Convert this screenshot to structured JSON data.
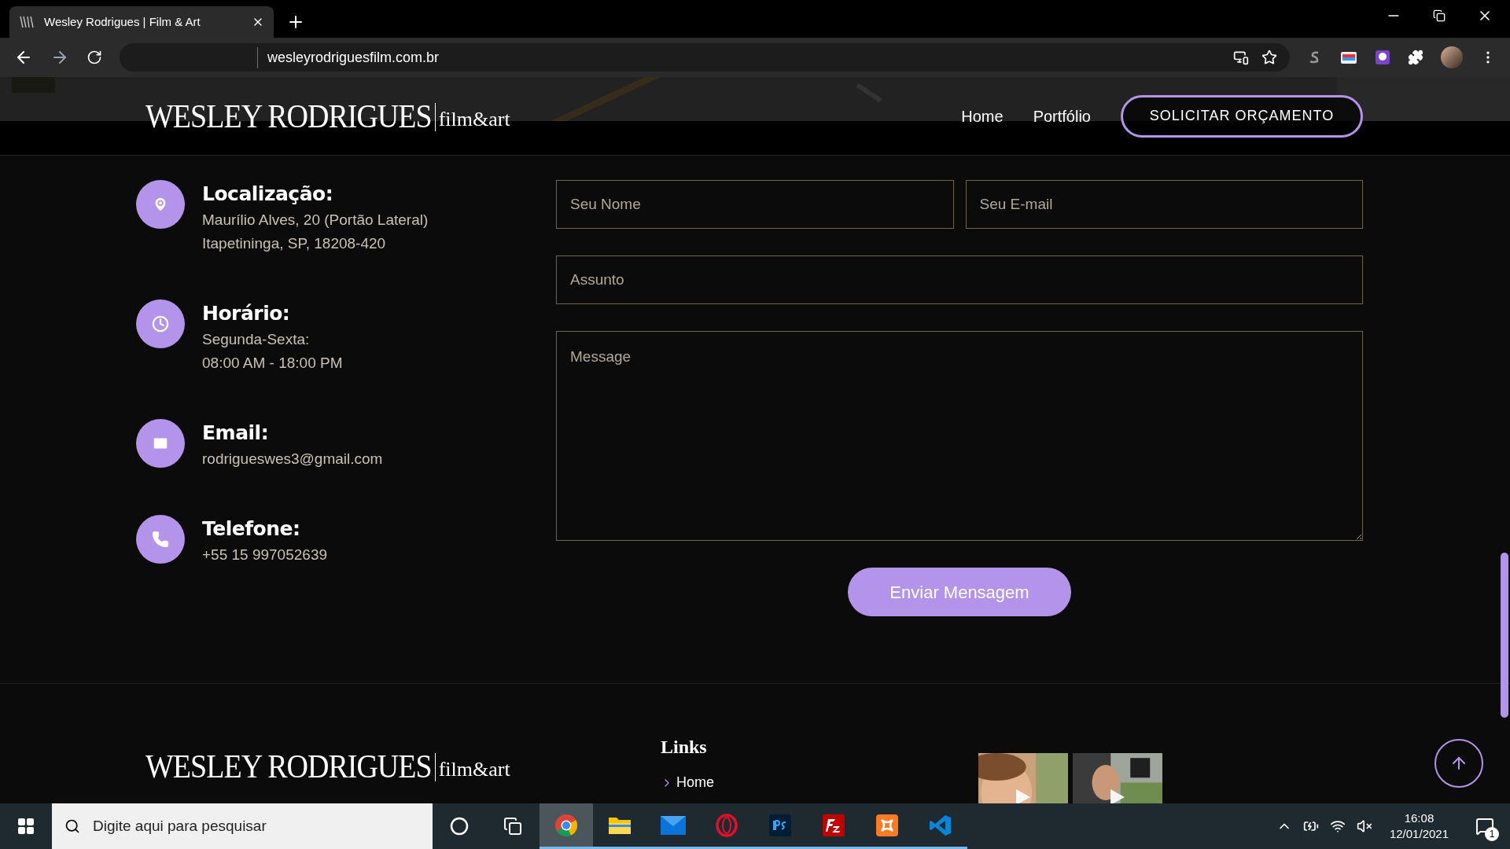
{
  "browser": {
    "tab": {
      "title": "Wesley Rodrigues | Film & Art"
    },
    "address": "wesleyrodriguesfilm.com.br"
  },
  "header": {
    "logo": {
      "name": "WESLEY RODRIGUES",
      "tagline": "film&art"
    },
    "nav": [
      {
        "label": "Home"
      },
      {
        "label": "Portfólio"
      }
    ],
    "cta": "SOLICITAR ORÇAMENTO"
  },
  "contact": [
    {
      "kind": "location",
      "title": "Localização:",
      "lines": [
        "Maurílio Alves, 20 (Portão Lateral)",
        "Itapetininga, SP, 18208-420"
      ]
    },
    {
      "kind": "hours",
      "title": "Horário:",
      "lines": [
        "Segunda-Sexta:",
        "08:00 AM - 18:00 PM"
      ]
    },
    {
      "kind": "email",
      "title": "Email:",
      "lines": [
        "rodrigueswes3@gmail.com"
      ]
    },
    {
      "kind": "phone",
      "title": "Telefone:",
      "lines": [
        "+55 15 997052639"
      ]
    }
  ],
  "form": {
    "name_placeholder": "Seu Nome",
    "email_placeholder": "Seu E-mail",
    "subject_placeholder": "Assunto",
    "message_placeholder": "Message",
    "submit": "Enviar Mensagem"
  },
  "footer": {
    "logo": {
      "name": "WESLEY RODRIGUES",
      "tagline": "film&art"
    },
    "links_title": "Links",
    "links": [
      "Home"
    ],
    "videos": [
      {
        "kind": "picture"
      },
      {
        "kind": "picture"
      }
    ]
  },
  "taskbar": {
    "search_placeholder": "Digite aqui para pesquisar",
    "apps": [
      {
        "kind": "chrome",
        "selected": true
      },
      {
        "kind": "explorer",
        "selected": false
      },
      {
        "kind": "mail",
        "selected": false
      },
      {
        "kind": "opera",
        "selected": false
      },
      {
        "kind": "photoshop",
        "selected": false
      },
      {
        "kind": "filezilla",
        "selected": false
      },
      {
        "kind": "xampp",
        "selected": false
      },
      {
        "kind": "vscode",
        "selected": false
      }
    ],
    "time": "16:08",
    "date": "12/01/2021",
    "notifications": "1"
  }
}
